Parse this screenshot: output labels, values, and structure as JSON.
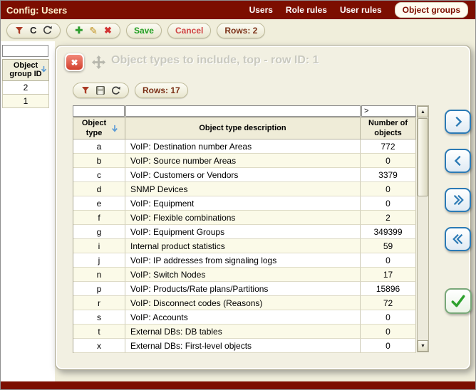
{
  "colors": {
    "maroon": "#7c0e00",
    "beige": "#f0eedb",
    "accent_blue": "#2b7ab5",
    "save_green": "#1f9e1f",
    "cancel_red": "#d04343",
    "row_alt": "#fbfae8"
  },
  "header": {
    "title": "Config: Users",
    "tabs": [
      "Users",
      "Role rules",
      "User rules",
      "Object groups"
    ],
    "active_tab": "Object groups"
  },
  "toolbar": {
    "save": "Save",
    "cancel": "Cancel",
    "rows_badge": "Rows: 2"
  },
  "icons": {
    "clear": "C",
    "add": "✚",
    "edit": "✎",
    "delete": "✖",
    "close": "✖",
    "scroll_up": "▲",
    "scroll_down": "▼",
    "filter": "funnel-shape",
    "save_disk": "floppy-disk",
    "refresh": "circular-arrow",
    "move": "four-arrows",
    "sort": "blue-down-arrow",
    "nav_right": "chevron-right",
    "nav_left": "chevron-left",
    "nav_all_right": "double-chevron-right",
    "nav_all_left": "double-chevron-left",
    "confirm": "green-checkmark"
  },
  "background_table": {
    "filter_value": "",
    "column_header": "Object group ID",
    "rows": [
      "2",
      "1"
    ]
  },
  "dialog": {
    "title": "Object types to include, top - row ID: 1",
    "rows_badge": "Rows: 17",
    "filters": {
      "object_type": "",
      "description": "",
      "count": ">"
    },
    "columns": {
      "c1": "Object type",
      "c2": "Object type description",
      "c3": "Number of objects"
    },
    "rows": [
      {
        "type": "a",
        "description": "VoIP: Destination number Areas",
        "count": "772"
      },
      {
        "type": "b",
        "description": "VoIP: Source number Areas",
        "count": "0"
      },
      {
        "type": "c",
        "description": "VoIP: Customers or Vendors",
        "count": "3379"
      },
      {
        "type": "d",
        "description": "SNMP Devices",
        "count": "0"
      },
      {
        "type": "e",
        "description": "VoIP: Equipment",
        "count": "0"
      },
      {
        "type": "f",
        "description": "VoIP: Flexible combinations",
        "count": "2"
      },
      {
        "type": "g",
        "description": "VoIP: Equipment Groups",
        "count": "349399"
      },
      {
        "type": "i",
        "description": "Internal product statistics",
        "count": "59"
      },
      {
        "type": "j",
        "description": "VoIP: IP addresses from signaling logs",
        "count": "0"
      },
      {
        "type": "n",
        "description": "VoIP: Switch Nodes",
        "count": "17"
      },
      {
        "type": "p",
        "description": "VoIP: Products/Rate plans/Partitions",
        "count": "15896"
      },
      {
        "type": "r",
        "description": "VoIP: Disconnect codes (Reasons)",
        "count": "72"
      },
      {
        "type": "s",
        "description": "VoIP: Accounts",
        "count": "0"
      },
      {
        "type": "t",
        "description": "External DBs: DB tables",
        "count": "0"
      },
      {
        "type": "x",
        "description": "External DBs: First-level objects",
        "count": "0"
      }
    ]
  }
}
